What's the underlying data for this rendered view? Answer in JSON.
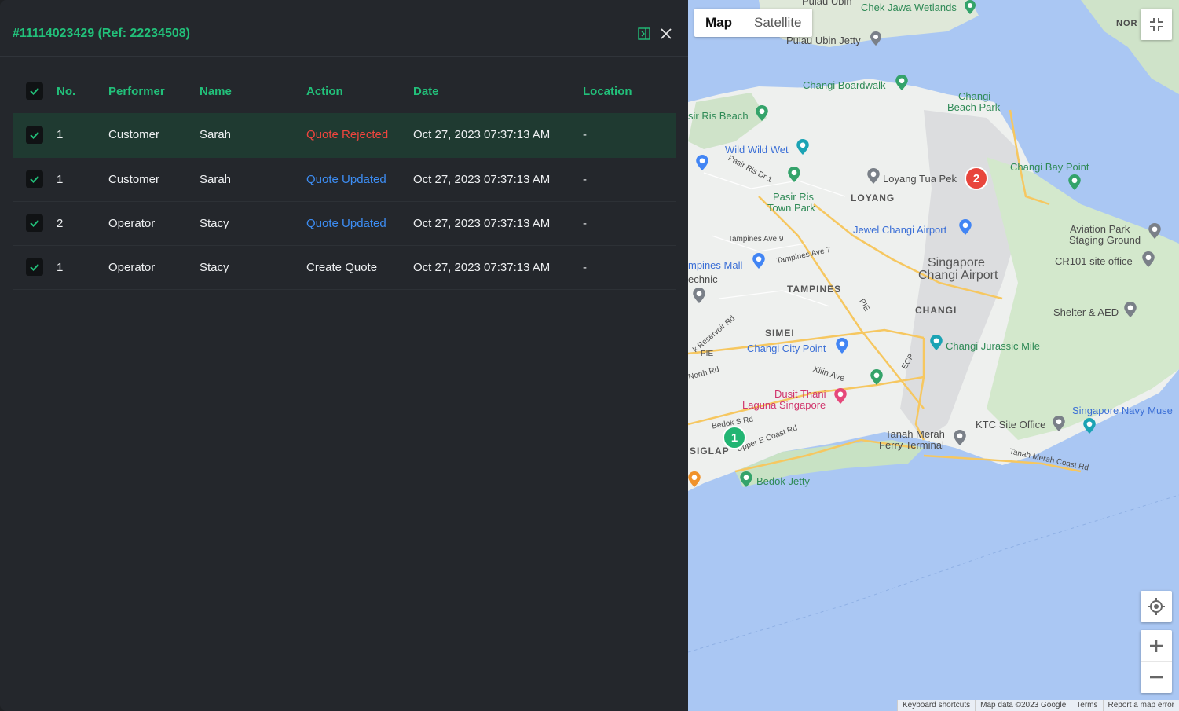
{
  "panel": {
    "title_prefix": "#11114023429 (Ref: ",
    "ref": "22234508",
    "title_suffix": ")",
    "columns": [
      "No.",
      "Performer",
      "Name",
      "Action",
      "Date",
      "Location"
    ],
    "rows": [
      {
        "no": "1",
        "performer": "Customer",
        "name": "Sarah",
        "action": "Quote Rejected",
        "date": "Oct 27, 2023 07:37:13 AM",
        "location": "-"
      },
      {
        "no": "1",
        "performer": "Customer",
        "name": "Sarah",
        "action": "Quote Updated",
        "date": "Oct 27, 2023 07:37:13 AM",
        "location": "-"
      },
      {
        "no": "2",
        "performer": "Operator",
        "name": "Stacy",
        "action": "Quote Updated",
        "date": "Oct 27, 2023 07:37:13 AM",
        "location": "-"
      },
      {
        "no": "1",
        "performer": "Operator",
        "name": "Stacy",
        "action": "Create Quote",
        "date": "Oct 27, 2023 07:37:13 AM",
        "location": "-"
      }
    ]
  },
  "map": {
    "type_map": "Map",
    "type_satellite": "Satellite",
    "footer": {
      "shortcuts": "Keyboard shortcuts",
      "data": "Map data ©2023 Google",
      "terms": "Terms",
      "report": "Report a map error"
    },
    "markers": {
      "a": "1",
      "b": "2"
    },
    "labels": {
      "pulau_ubin": "Pulau Ubin",
      "chek_jawa": "Chek Jawa Wetlands",
      "pulau_ubin_jetty": "Pulau Ubin Jetty",
      "changi_boardwalk": "Changi Boardwalk",
      "changi_beach_park_1": "Changi",
      "changi_beach_park_2": "Beach Park",
      "pasir_ris_beach": "sir Ris Beach",
      "wild_wild_wet": "Wild Wild Wet",
      "pasir_ris_dr": "Pasir Ris Dr 1",
      "loyang_tua_pek": "Loyang Tua Pek",
      "loyang": "LOYANG",
      "changi_bay_point": "Changi Bay Point",
      "pasir_ris_town_park_1": "Pasir Ris",
      "pasir_ris_town_park_2": "Town Park",
      "jewel": "Jewel Changi Airport",
      "aviation_park_1": "Aviation Park",
      "aviation_park_2": "Staging Ground",
      "tampines_ave9": "Tampines Ave 9",
      "tampines_ave7": "Tampines Ave 7",
      "cr101": "CR101 site office",
      "tampines_mall": "mpines Mall",
      "polytechnic": "echnic",
      "singapore_changi_airport_1": "Singapore",
      "singapore_changi_airport_2": "Changi Airport",
      "tampines": "TAMPINES",
      "changi": "CHANGI",
      "shelter_aed": "Shelter & AED",
      "simei": "SIMEI",
      "pie_1": "PIE",
      "pie_2": "PIE",
      "changi_city_point": "Changi City Point",
      "changi_jurassic": "Changi Jurassic Mile",
      "reservoir_rd": "k Reservoir Rd",
      "xilin_ave": "Xilin Ave",
      "north_rd": "North Rd",
      "ecp": "ECP",
      "dusit_1": "Dusit Thani",
      "dusit_2": "Laguna Singapore",
      "bedok_s_rd": "Bedok S Rd",
      "upper_e_coast": "Upper E Coast Rd",
      "siglap": "SIGLAP",
      "tanah_merah_1": "Tanah Merah",
      "tanah_merah_2": "Ferry Terminal",
      "ktc": "KTC Site Office",
      "navy_museum": "Singapore Navy Muse",
      "tanah_merah_coast": "Tanah Merah Coast Rd",
      "bedok_jetty": "Bedok Jetty",
      "north_edge": "NOR"
    }
  }
}
